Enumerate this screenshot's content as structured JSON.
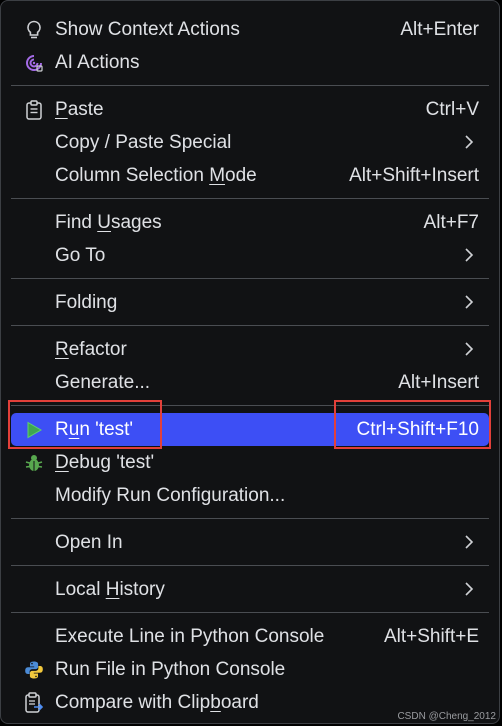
{
  "menu": {
    "groups": [
      [
        {
          "label": "Show Context Actions",
          "shortcut": "Alt+Enter",
          "icon": "lightbulb-icon"
        },
        {
          "label": "AI Actions",
          "icon": "ai-spiral-icon"
        }
      ],
      [
        {
          "label_pre": "",
          "label_u": "P",
          "label_post": "aste",
          "shortcut": "Ctrl+V",
          "icon": "clipboard-icon"
        },
        {
          "label": "Copy / Paste Special",
          "submenu": true
        },
        {
          "label_pre": "Column Selection ",
          "label_u": "M",
          "label_post": "ode",
          "shortcut": "Alt+Shift+Insert"
        }
      ],
      [
        {
          "label_pre": "Find ",
          "label_u": "U",
          "label_post": "sages",
          "shortcut": "Alt+F7"
        },
        {
          "label": "Go To",
          "submenu": true
        }
      ],
      [
        {
          "label": "Folding",
          "submenu": true
        }
      ],
      [
        {
          "label_pre": "",
          "label_u": "R",
          "label_post": "efactor",
          "submenu": true
        },
        {
          "label": "Generate...",
          "shortcut": "Alt+Insert"
        }
      ],
      [
        {
          "label_pre": "R",
          "label_u": "u",
          "label_post": "n 'test'",
          "shortcut": "Ctrl+Shift+F10",
          "icon": "run-play-icon",
          "selected": true
        },
        {
          "label_pre": "",
          "label_u": "D",
          "label_post": "ebug 'test'",
          "icon": "debug-bug-icon"
        },
        {
          "label": "Modify Run Configuration..."
        }
      ],
      [
        {
          "label": "Open In",
          "submenu": true
        }
      ],
      [
        {
          "label_pre": "Local ",
          "label_u": "H",
          "label_post": "istory",
          "submenu": true
        }
      ],
      [
        {
          "label": "Execute Line in Python Console",
          "shortcut": "Alt+Shift+E"
        },
        {
          "label": "Run File in Python Console",
          "icon": "python-logo-icon"
        },
        {
          "label_pre": "Compare with Clip",
          "label_u": "b",
          "label_post": "oard",
          "icon": "compare-clipboard-icon"
        }
      ]
    ]
  },
  "colors": {
    "background": "#111214",
    "selected": "#3d4ff5",
    "text": "#dfe1e5",
    "highlight_box": "#e2403a"
  },
  "watermark": "CSDN @Cheng_2012"
}
